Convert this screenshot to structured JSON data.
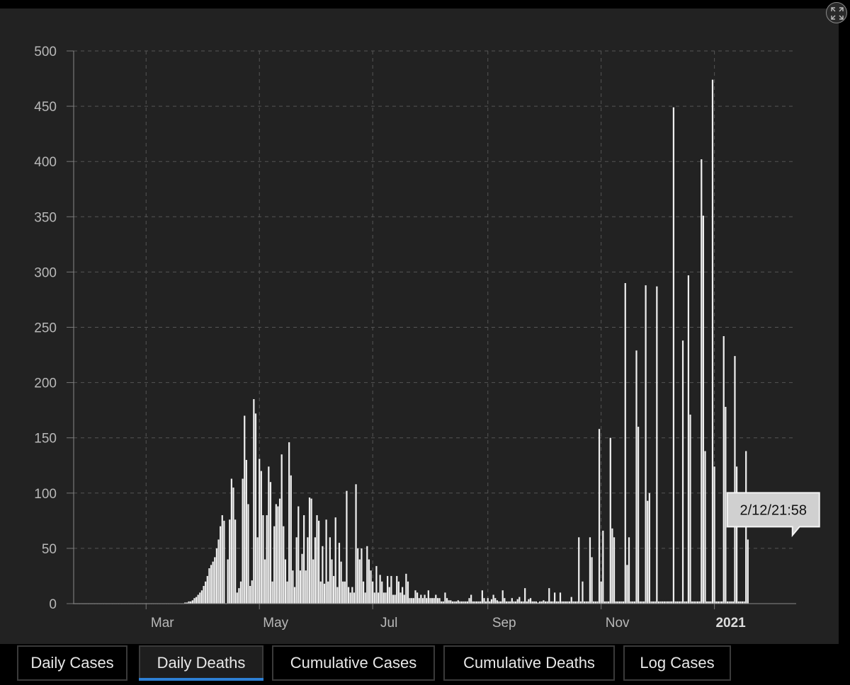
{
  "chart_data": {
    "type": "bar",
    "title": "",
    "xlabel": "",
    "ylabel": "",
    "ylim": [
      0,
      500
    ],
    "yticks": [
      0,
      50,
      100,
      150,
      200,
      250,
      300,
      350,
      400,
      450,
      500
    ],
    "xlim": [
      "2020-01-22",
      "2021-02-14"
    ],
    "xticks": [
      {
        "date": "2020-03-01",
        "label": "Mar",
        "bold": false
      },
      {
        "date": "2020-05-01",
        "label": "May",
        "bold": false
      },
      {
        "date": "2020-07-01",
        "label": "Jul",
        "bold": false
      },
      {
        "date": "2020-09-01",
        "label": "Sep",
        "bold": false
      },
      {
        "date": "2020-11-01",
        "label": "Nov",
        "bold": false
      },
      {
        "date": "2021-01-01",
        "label": "2021",
        "bold": true
      }
    ],
    "grid": true,
    "bar_color": "#eeeeee",
    "series": [
      {
        "start_date": "2020-01-22",
        "values": [
          0,
          0,
          0,
          0,
          0,
          0,
          0,
          0,
          0,
          0,
          0,
          0,
          0,
          0,
          0,
          0,
          0,
          0,
          0,
          0,
          0,
          0,
          0,
          0,
          0,
          0,
          0,
          0,
          0,
          0,
          0,
          0,
          0,
          0,
          0,
          0,
          0,
          0,
          0,
          0,
          0,
          0,
          0,
          0,
          0,
          0,
          0,
          0,
          0,
          0,
          0,
          0,
          0,
          0,
          0,
          0,
          0,
          0,
          0,
          0,
          1,
          1,
          2,
          2,
          3,
          5,
          6,
          8,
          10,
          12,
          16,
          20,
          25,
          32,
          35,
          38,
          42,
          50,
          58,
          70,
          80,
          75,
          0,
          40,
          76,
          113,
          105,
          76,
          10,
          14,
          20,
          113,
          170,
          130,
          90,
          16,
          21,
          185,
          172,
          60,
          131,
          120,
          80,
          40,
          80,
          124,
          110,
          20,
          70,
          90,
          88,
          95,
          135,
          70,
          40,
          20,
          146,
          116,
          30,
          15,
          60,
          88,
          30,
          45,
          80,
          30,
          60,
          96,
          95,
          40,
          60,
          80,
          75,
          20,
          52,
          18,
          76,
          20,
          60,
          40,
          25,
          78,
          15,
          55,
          38,
          20,
          20,
          102,
          15,
          10,
          15,
          10,
          108,
          50,
          40,
          50,
          20,
          10,
          52,
          40,
          30,
          20,
          10,
          34,
          10,
          26,
          20,
          10,
          10,
          25,
          15,
          25,
          8,
          8,
          25,
          20,
          10,
          15,
          8,
          27,
          20,
          5,
          5,
          5,
          12,
          10,
          5,
          8,
          5,
          8,
          5,
          12,
          5,
          5,
          5,
          8,
          5,
          5,
          2,
          2,
          10,
          5,
          3,
          3,
          2,
          2,
          2,
          3,
          2,
          2,
          2,
          2,
          2,
          5,
          8,
          2,
          2,
          2,
          2,
          2,
          12,
          5,
          2,
          5,
          2,
          4,
          8,
          5,
          3,
          2,
          2,
          12,
          5,
          2,
          2,
          2,
          5,
          2,
          2,
          4,
          6,
          2,
          2,
          14,
          2,
          4,
          5,
          2,
          2,
          2,
          1,
          2,
          2,
          3,
          2,
          2,
          14,
          2,
          2,
          10,
          2,
          2,
          10,
          2,
          2,
          2,
          2,
          2,
          6,
          2,
          2,
          2,
          60,
          2,
          20,
          2,
          2,
          2,
          60,
          42,
          2,
          2,
          2,
          158,
          20,
          66,
          2,
          2,
          2,
          150,
          68,
          60,
          2,
          2,
          2,
          2,
          2,
          290,
          35,
          60,
          2,
          2,
          2,
          229,
          160,
          2,
          2,
          2,
          288,
          93,
          100,
          2,
          2,
          2,
          287,
          2,
          2,
          2,
          2,
          2,
          2,
          2,
          2,
          449,
          2,
          2,
          2,
          2,
          238,
          2,
          2,
          297,
          171,
          2,
          2,
          2,
          2,
          2,
          402,
          351,
          138,
          2,
          2,
          2,
          474,
          124,
          2,
          2,
          2,
          2,
          242,
          178,
          2,
          2,
          2,
          2,
          224,
          124,
          2,
          2,
          2,
          2,
          138,
          58
        ]
      }
    ],
    "tooltip": {
      "text": "2/12/21:58",
      "date": "2021-02-12",
      "value": 58
    }
  },
  "tabs": [
    {
      "label": "Daily Cases",
      "active": false
    },
    {
      "label": "Daily Deaths",
      "active": true
    },
    {
      "label": "Cumulative Cases",
      "active": false
    },
    {
      "label": "Cumulative Deaths",
      "active": false
    },
    {
      "label": "Log Cases",
      "active": false
    }
  ],
  "colors": {
    "background": "#000000",
    "panel": "#222222",
    "grid": "#555555",
    "axis_text": "#b8b8b8",
    "bar": "#eeeeee",
    "active_tab_accent": "#2d7fd3"
  },
  "icons": {
    "expand": "expand-icon"
  }
}
